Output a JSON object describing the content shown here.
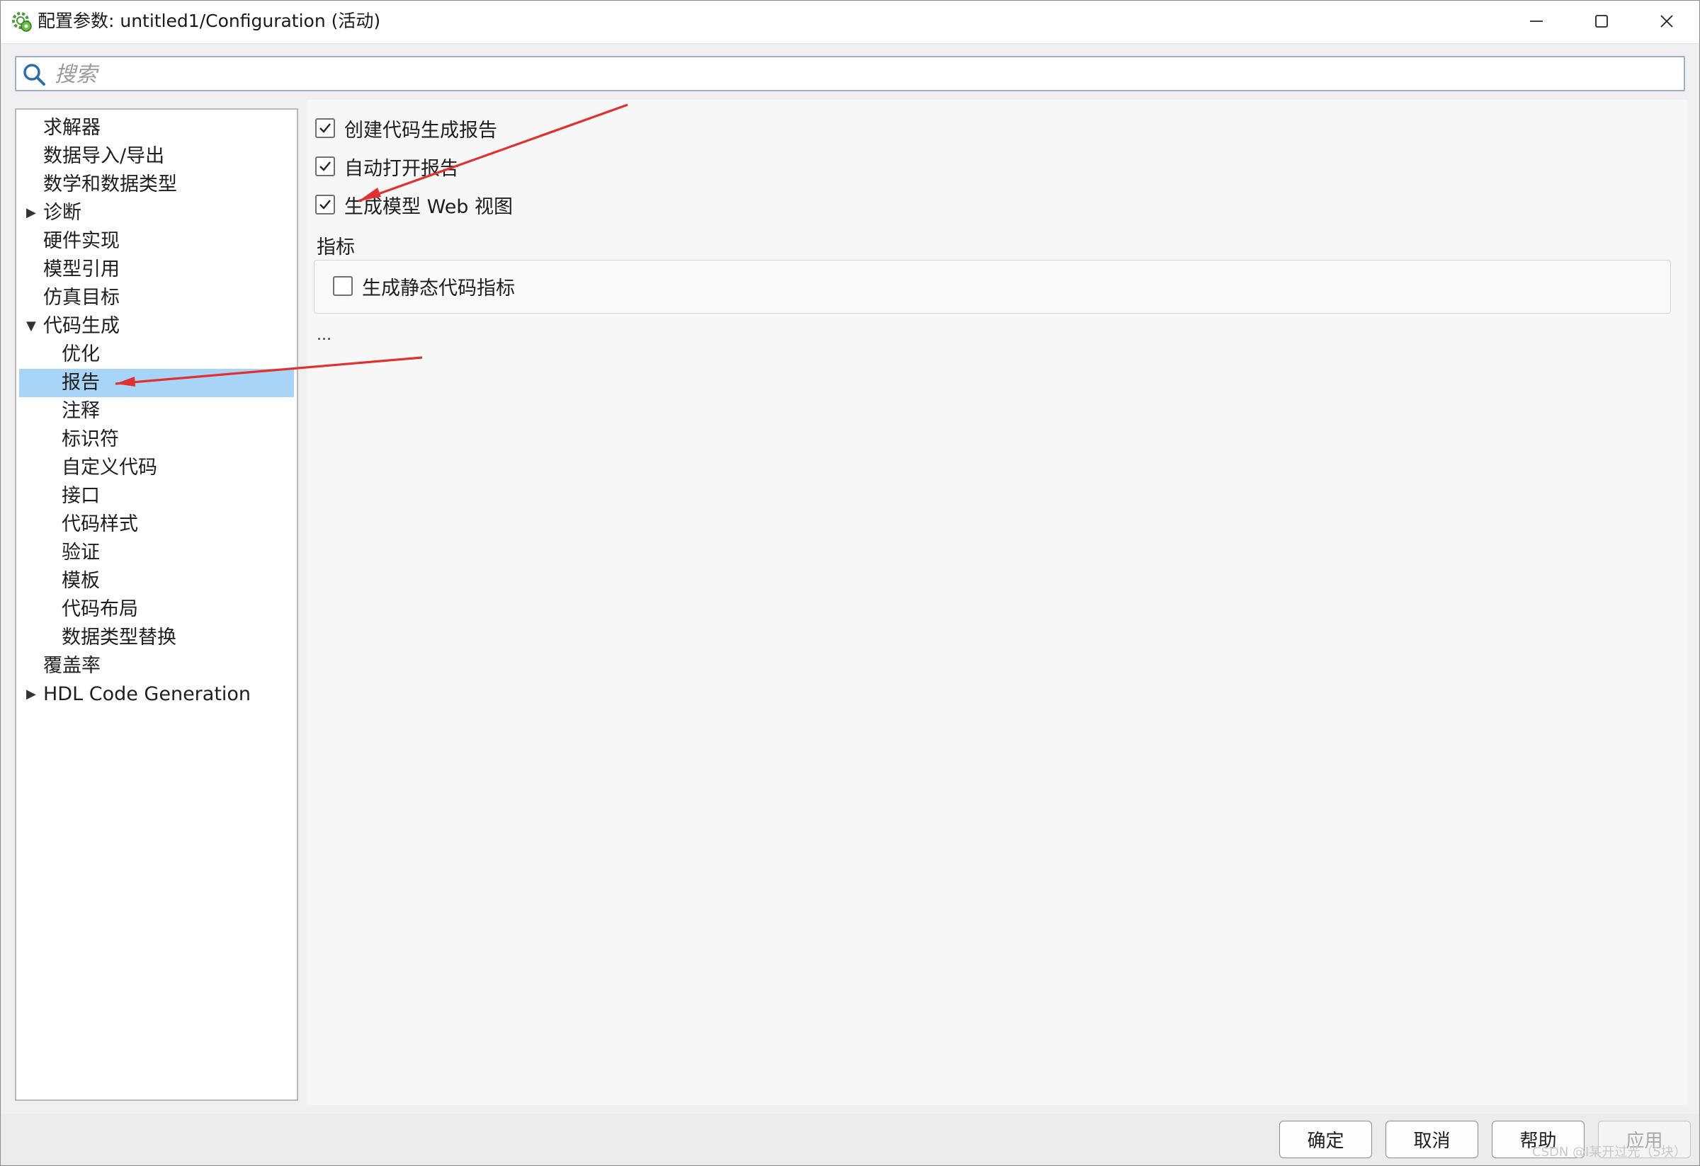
{
  "window": {
    "title": "配置参数: untitled1/Configuration (活动)",
    "minimize_icon": "minimize-icon",
    "maximize_icon": "maximize-icon",
    "close_icon": "close-icon"
  },
  "search": {
    "placeholder": "搜索",
    "value": "",
    "icon": "search-icon"
  },
  "tree": {
    "items": [
      {
        "label": "求解器",
        "level": 0,
        "expander": ""
      },
      {
        "label": "数据导入/导出",
        "level": 0,
        "expander": ""
      },
      {
        "label": "数学和数据类型",
        "level": 0,
        "expander": ""
      },
      {
        "label": "诊断",
        "level": 0,
        "expander": "collapsed"
      },
      {
        "label": "硬件实现",
        "level": 0,
        "expander": ""
      },
      {
        "label": "模型引用",
        "level": 0,
        "expander": ""
      },
      {
        "label": "仿真目标",
        "level": 0,
        "expander": ""
      },
      {
        "label": "代码生成",
        "level": 0,
        "expander": "expanded"
      },
      {
        "label": "优化",
        "level": 1,
        "expander": ""
      },
      {
        "label": "报告",
        "level": 1,
        "expander": "",
        "selected": true
      },
      {
        "label": "注释",
        "level": 1,
        "expander": ""
      },
      {
        "label": "标识符",
        "level": 1,
        "expander": ""
      },
      {
        "label": "自定义代码",
        "level": 1,
        "expander": ""
      },
      {
        "label": "接口",
        "level": 1,
        "expander": ""
      },
      {
        "label": "代码样式",
        "level": 1,
        "expander": ""
      },
      {
        "label": "验证",
        "level": 1,
        "expander": ""
      },
      {
        "label": "模板",
        "level": 1,
        "expander": ""
      },
      {
        "label": "代码布局",
        "level": 1,
        "expander": ""
      },
      {
        "label": "数据类型替换",
        "level": 1,
        "expander": ""
      },
      {
        "label": "覆盖率",
        "level": 0,
        "expander": ""
      },
      {
        "label": "HDL Code Generation",
        "level": 0,
        "expander": "collapsed"
      }
    ],
    "selected_color": "#a8d4f7"
  },
  "report": {
    "options": [
      {
        "label": "创建代码生成报告",
        "checked": true
      },
      {
        "label": "自动打开报告",
        "checked": true
      },
      {
        "label": "生成模型 Web 视图",
        "checked": true
      }
    ],
    "metrics_section": {
      "title": "指标",
      "option": {
        "label": "生成静态代码指标",
        "checked": false
      }
    },
    "more": "..."
  },
  "buttons": {
    "ok": "确定",
    "cancel": "取消",
    "help": "帮助",
    "apply": "应用",
    "apply_enabled": false
  },
  "watermark": "CSDN @I某开过光（5块）",
  "annotation_color": "#e03030"
}
